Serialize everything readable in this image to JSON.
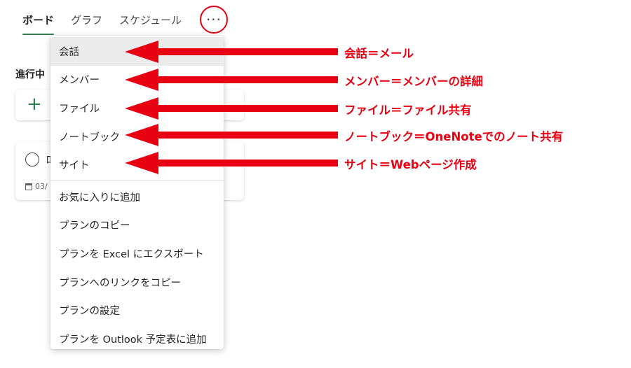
{
  "tabs": [
    {
      "label": "ボード",
      "active": true
    },
    {
      "label": "グラフ",
      "active": false
    },
    {
      "label": "スケジュール",
      "active": false
    }
  ],
  "more_button": {
    "label": "···"
  },
  "board": {
    "column_title": "進行中",
    "add_task_icon": "plus-icon",
    "task": {
      "title_fragment": "ﾛ",
      "date_fragment": "03/"
    }
  },
  "menu": {
    "items": [
      {
        "label": "会話",
        "highlighted": true
      },
      {
        "label": "メンバー"
      },
      {
        "label": "ファイル"
      },
      {
        "label": "ノートブック"
      },
      {
        "label": "サイト"
      }
    ],
    "items_lower": [
      {
        "label": "お気に入りに追加"
      },
      {
        "label": "プランのコピー"
      },
      {
        "label": "プランを Excel にエクスポート"
      },
      {
        "label": "プランへのリンクをコピー"
      },
      {
        "label": "プランの設定"
      },
      {
        "label": "プランを Outlook 予定表に追加"
      }
    ]
  },
  "annotations": [
    {
      "text": "会話＝メール"
    },
    {
      "text": "メンバー＝メンバーの詳細"
    },
    {
      "text": "ファイル＝ファイル共有"
    },
    {
      "text": "ノートブック＝OneNoteでのノート共有"
    },
    {
      "text": "サイト＝Webページ作成"
    }
  ],
  "colors": {
    "annotation_red": "#e60012",
    "active_tab_underline": "#2e7d4f"
  }
}
